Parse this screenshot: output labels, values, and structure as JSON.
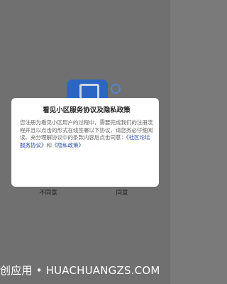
{
  "dialog": {
    "title": "看见小区服务协议及隐私政策",
    "body_text": "您注册为看见小区用户的过程中，需要完成我们的注册流程并且以点击的形式在线签署以下协议，请您务必仔细阅读、充分理解协议中的条款内容后点击同意：",
    "link_service": "《社区论坛服务协议》",
    "conjunction": "和",
    "link_privacy": "《隐私政策》",
    "disagree_label": "不同意",
    "agree_label": "同意"
  },
  "watermark": {
    "text": "创应用 • HUACHUANGZS.COM"
  },
  "colors": {
    "backdrop": "#7a7a7a",
    "dialog_bg": "#ffffff",
    "link": "#2b4fa8",
    "app_icon": "#2f6fd6"
  },
  "icons": {
    "background_app": "app-logo-icon"
  }
}
